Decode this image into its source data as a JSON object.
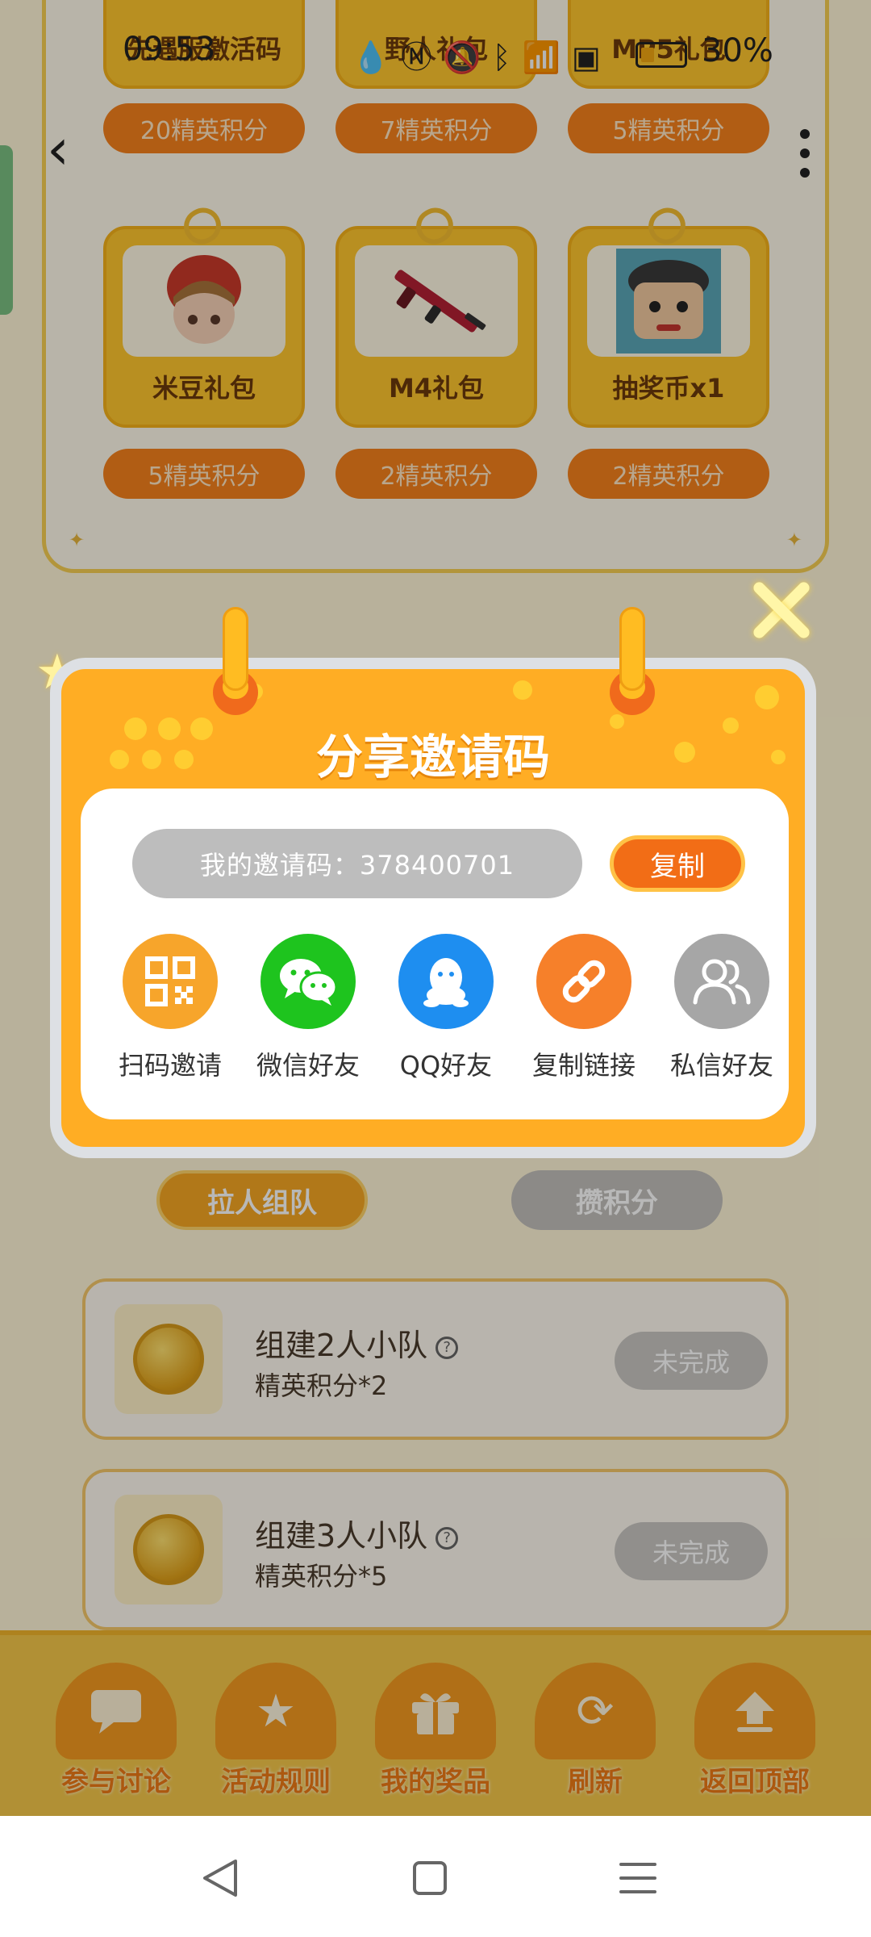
{
  "status_bar": {
    "time": "09:53",
    "icons": [
      "water-drop-icon",
      "nfc-icon",
      "mute-icon",
      "bluetooth-icon",
      "wifi-icon",
      "sim-icon"
    ],
    "battery_percent": "30%"
  },
  "rewards": {
    "top_row": [
      {
        "name": "先遇服激活码",
        "cost": "20精英积分"
      },
      {
        "name": "野人礼包",
        "cost": "7精英积分"
      },
      {
        "name": "MP5礼包",
        "cost": "5精英积分"
      }
    ],
    "second_row": [
      {
        "name": "米豆礼包",
        "cost": "5精英积分"
      },
      {
        "name": "M4礼包",
        "cost": "2精英积分"
      },
      {
        "name": "抽奖币x1",
        "cost": "2精英积分"
      }
    ]
  },
  "team": {
    "tab_invite": "拉人组队",
    "tab_points": "攒积分",
    "tasks": [
      {
        "title": "组建2人小队",
        "reward": "精英积分*2",
        "status": "未完成"
      },
      {
        "title": "组建3人小队",
        "reward": "精英积分*5",
        "status": "未完成"
      }
    ]
  },
  "bottom_menu": [
    {
      "label": "参与讨论",
      "icon": "chat-icon"
    },
    {
      "label": "活动规则",
      "icon": "star-icon"
    },
    {
      "label": "我的奖品",
      "icon": "gift-icon"
    },
    {
      "label": "刷新",
      "icon": "refresh-icon"
    },
    {
      "label": "返回顶部",
      "icon": "upload-icon"
    }
  ],
  "modal": {
    "title": "分享邀请码",
    "invite_code_text": "我的邀请码：378400701",
    "copy_label": "复制",
    "share_options": [
      {
        "label": "扫码邀请",
        "icon": "qr-code-icon",
        "color": "#f7a52b"
      },
      {
        "label": "微信好友",
        "icon": "wechat-icon",
        "color": "#1ec41e"
      },
      {
        "label": "QQ好友",
        "icon": "qq-icon",
        "color": "#1e8ef0"
      },
      {
        "label": "复制链接",
        "icon": "link-icon",
        "color": "#f6802a"
      },
      {
        "label": "私信好友",
        "icon": "friends-icon",
        "color": "#a6a6a6"
      }
    ]
  },
  "colors": {
    "accent_orange": "#ffad24",
    "copy_button": "#f26d16",
    "overlay": "rgba(0,0,0,0.28)"
  }
}
